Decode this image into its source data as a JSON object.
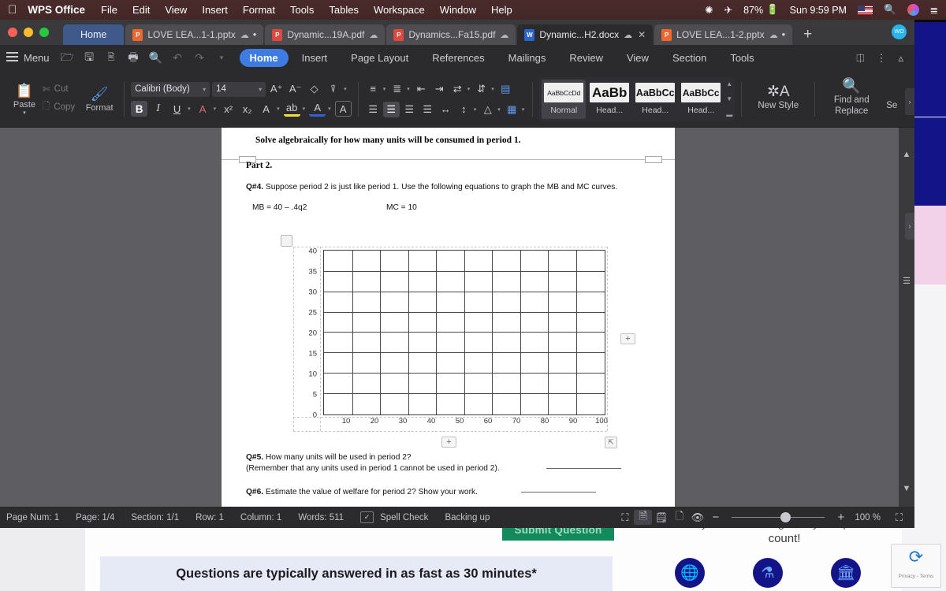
{
  "menubar": {
    "apple": "apple-logo",
    "app": "WPS Office",
    "items": [
      "File",
      "Edit",
      "View",
      "Insert",
      "Format",
      "Tools",
      "Tables",
      "Workspace",
      "Window",
      "Help"
    ],
    "status": {
      "battery": "87%",
      "clock": "Sun 9:59 PM",
      "input_source": "US flag"
    }
  },
  "tabbar": {
    "home": "Home",
    "tabs": [
      {
        "label": "LOVE LEA...1-1.pptx",
        "type": "P",
        "cloud": true,
        "modified": true,
        "active": false
      },
      {
        "label": "Dynamic...19A.pdf",
        "type": "P",
        "cloud": true,
        "modified": false,
        "active": false
      },
      {
        "label": "Dynamics...Fa15.pdf",
        "type": "P",
        "cloud": true,
        "modified": false,
        "active": false
      },
      {
        "label": "Dynamic...H2.docx",
        "type": "W",
        "cloud": true,
        "modified": false,
        "active": true
      },
      {
        "label": "LOVE LEA...1-2.pptx",
        "type": "P",
        "cloud": true,
        "modified": true,
        "active": false
      }
    ],
    "new_tab": "+",
    "avatar": "WO"
  },
  "ribbon": {
    "menu_label": "Menu",
    "quick_access": [
      "open-icon",
      "save-icon",
      "export-pdf-icon",
      "print-icon",
      "print-preview-icon",
      "undo-icon",
      "redo-icon",
      "customize-icon"
    ],
    "tabs": [
      "Home",
      "Insert",
      "Page Layout",
      "References",
      "Mailings",
      "Review",
      "View",
      "Section",
      "Tools"
    ],
    "selected_tab": "Home",
    "right_actions": [
      "share-icon",
      "more-icon",
      "collapse-ribbon-icon"
    ],
    "accent_color": "#3e7ce4"
  },
  "toolbar": {
    "paste": "Paste",
    "cut": "Cut",
    "copy": "Copy",
    "format_painter": "Format",
    "font_name": "Calibri (Body)",
    "font_size": "14",
    "font_buttons": [
      "grow-font-icon",
      "shrink-font-icon",
      "clear-format-icon",
      "text-highlight-effect-icon"
    ],
    "style_buttons": [
      "bold",
      "italic",
      "underline",
      "font-color",
      "superscript",
      "subscript",
      "text-effects",
      "highlight-color",
      "font-shading",
      "character-border"
    ],
    "bold_label": "B",
    "italic_label": "I",
    "underline_label": "U",
    "bold_active": true,
    "paragraph_buttons": [
      "bullets",
      "numbering",
      "decrease-indent",
      "increase-indent",
      "asian-layout",
      "line-sort",
      "show-marks",
      "align-left",
      "align-center",
      "align-right",
      "justify",
      "distribute",
      "line-spacing",
      "shading",
      "borders"
    ],
    "align_center_active": true,
    "styles": [
      {
        "preview": "AaBbCcDd",
        "label": "Normal",
        "selected": true,
        "size": "normal"
      },
      {
        "preview": "AaBb",
        "label": "Head...",
        "selected": false,
        "size": "h1"
      },
      {
        "preview": "AaBbCc",
        "label": "Head...",
        "selected": false,
        "size": "h2"
      },
      {
        "preview": "AaBbCc",
        "label": "Head...",
        "selected": false,
        "size": "h3"
      }
    ],
    "new_style": "New Style",
    "find_replace": "Find and Replace",
    "select_truncated": "Se"
  },
  "document": {
    "heading": "Solve algebraically for how many units will be consumed in period 1.",
    "part_label": "Part 2.",
    "q4_tag": "Q#4.",
    "q4_text": " Suppose period 2 is just like period 1. Use the following equations to graph the MB and MC curves.",
    "equation_mb": "MB = 40 – .4q2",
    "equation_mc": "MC = 10",
    "q5_tag": "Q#5.",
    "q5_text": " How many units will be used in period 2?",
    "q5_note": "(Remember that any units used in period 1 cannot be used in period 2).",
    "q6_tag": "Q#6.",
    "q6_text": " Estimate the value of welfare for period 2? Show your work."
  },
  "chart_data": {
    "type": "table",
    "title": "",
    "xlabel": "",
    "ylabel": "",
    "x_ticks": [
      10,
      20,
      30,
      40,
      50,
      60,
      70,
      80,
      90,
      100
    ],
    "y_ticks": [
      0,
      5,
      10,
      15,
      20,
      25,
      30,
      35,
      40
    ],
    "xlim": [
      0,
      100
    ],
    "ylim": [
      0,
      40
    ],
    "grid": true,
    "columns": 10,
    "rows": 8,
    "series": [],
    "values": [],
    "note": "empty grid for hand-drawing MB and MC curves",
    "add_row_button": "+",
    "add_column_button": "+",
    "move_handle": "move-icon",
    "resize_handle": "resize-icon"
  },
  "statusbar": {
    "page_num": "Page Num: 1",
    "page": "Page: 1/4",
    "section": "Section: 1/1",
    "row": "Row: 1",
    "column": "Column: 1",
    "words": "Words: 511",
    "spell_check": "Spell Check",
    "backing_up": "Backing up",
    "view_modes": [
      "fullscreen-icon",
      "page-view-icon",
      "outline-view-icon",
      "web-view-icon",
      "eye-protection-icon"
    ],
    "zoom_out": "−",
    "zoom_in": "+",
    "zoom_level": "100 %",
    "fit_icon": "fit-page-icon"
  },
  "background_page": {
    "submit_button": "Submit Question",
    "promo": "Questions are typically answered in as fast as 30 minutes*",
    "count_line1": "they don't count against your question",
    "count_line2": "count!",
    "badges": [
      "globe-icon",
      "lab-icon",
      "bank-icon"
    ],
    "recaptcha_label": "Privacy - Terms"
  }
}
